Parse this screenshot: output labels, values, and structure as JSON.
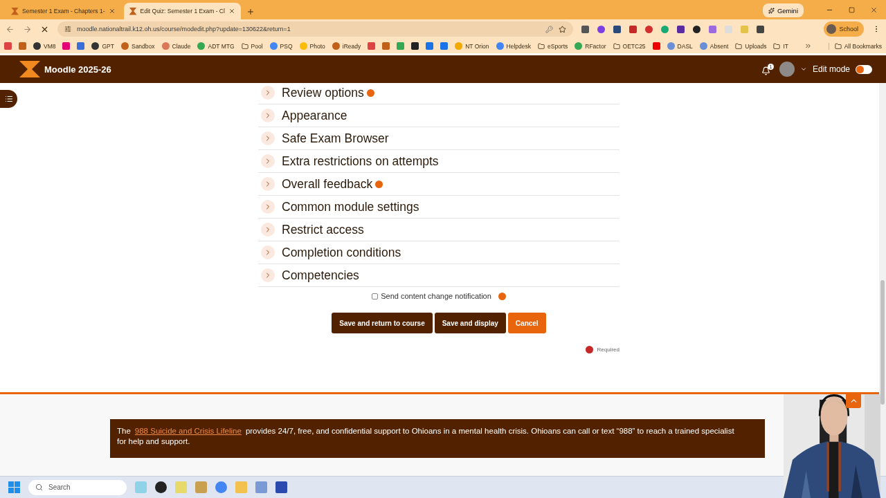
{
  "browser": {
    "tabs": [
      {
        "title": "Semester 1 Exam - Chapters 1-",
        "selected": false
      },
      {
        "title": "Edit Quiz: Semester 1 Exam - Cl",
        "selected": true
      }
    ],
    "gemini": "Gemini",
    "url": "moodle.nationaltrail.k12.oh.us/course/modedit.php?update=130622&return=1",
    "profile": "School",
    "bookmarks": [
      {
        "kind": "icon"
      },
      {
        "kind": "icon"
      },
      {
        "kind": "link",
        "label": "VM8"
      },
      {
        "kind": "icon"
      },
      {
        "kind": "icon"
      },
      {
        "kind": "link",
        "label": "GPT"
      },
      {
        "kind": "link",
        "label": "Sandbox"
      },
      {
        "kind": "link",
        "label": "Claude"
      },
      {
        "kind": "link",
        "label": "ADT MTG"
      },
      {
        "kind": "folder",
        "label": "Pool"
      },
      {
        "kind": "link",
        "label": "PSQ"
      },
      {
        "kind": "link",
        "label": "Photo"
      },
      {
        "kind": "link",
        "label": "iReady"
      },
      {
        "kind": "icon"
      },
      {
        "kind": "icon"
      },
      {
        "kind": "icon"
      },
      {
        "kind": "icon"
      },
      {
        "kind": "icon"
      },
      {
        "kind": "icon"
      },
      {
        "kind": "link",
        "label": "NT Orion"
      },
      {
        "kind": "link",
        "label": "Helpdesk"
      },
      {
        "kind": "folder",
        "label": "eSports"
      },
      {
        "kind": "link",
        "label": "RFactor"
      },
      {
        "kind": "folder",
        "label": "OETC25"
      },
      {
        "kind": "icon"
      },
      {
        "kind": "link",
        "label": "DASL"
      },
      {
        "kind": "link",
        "label": "Absent"
      },
      {
        "kind": "folder",
        "label": "Uploads"
      },
      {
        "kind": "folder",
        "label": "IT"
      }
    ],
    "all_bookmarks": "All Bookmarks"
  },
  "header": {
    "title": "Moodle 2025-26",
    "notifications": "1",
    "edit_mode": {
      "label": "Edit mode",
      "on": false
    }
  },
  "sections": [
    {
      "label": "Review options",
      "help": true
    },
    {
      "label": "Appearance",
      "help": false
    },
    {
      "label": "Safe Exam Browser",
      "help": false
    },
    {
      "label": "Extra restrictions on attempts",
      "help": false
    },
    {
      "label": "Overall feedback",
      "help": true
    },
    {
      "label": "Common module settings",
      "help": false
    },
    {
      "label": "Restrict access",
      "help": false
    },
    {
      "label": "Completion conditions",
      "help": false
    },
    {
      "label": "Competencies",
      "help": false
    }
  ],
  "notification": {
    "label": "Send content change notification",
    "checked": false,
    "help": true
  },
  "buttons": [
    {
      "kind": "primary",
      "label": "Save and return to course"
    },
    {
      "kind": "primary",
      "label": "Save and display"
    },
    {
      "kind": "cancel",
      "label": "Cancel"
    }
  ],
  "required": "Required",
  "footer": {
    "before": "The",
    "link": "988 Suicide and Crisis Lifeline",
    "after": "provides 24/7, free, and confidential support to Ohioans in a mental health crisis. Ohioans can call or text “988” to reach a trained specialist for help and support."
  },
  "taskbar": {
    "search_placeholder": "Search"
  }
}
